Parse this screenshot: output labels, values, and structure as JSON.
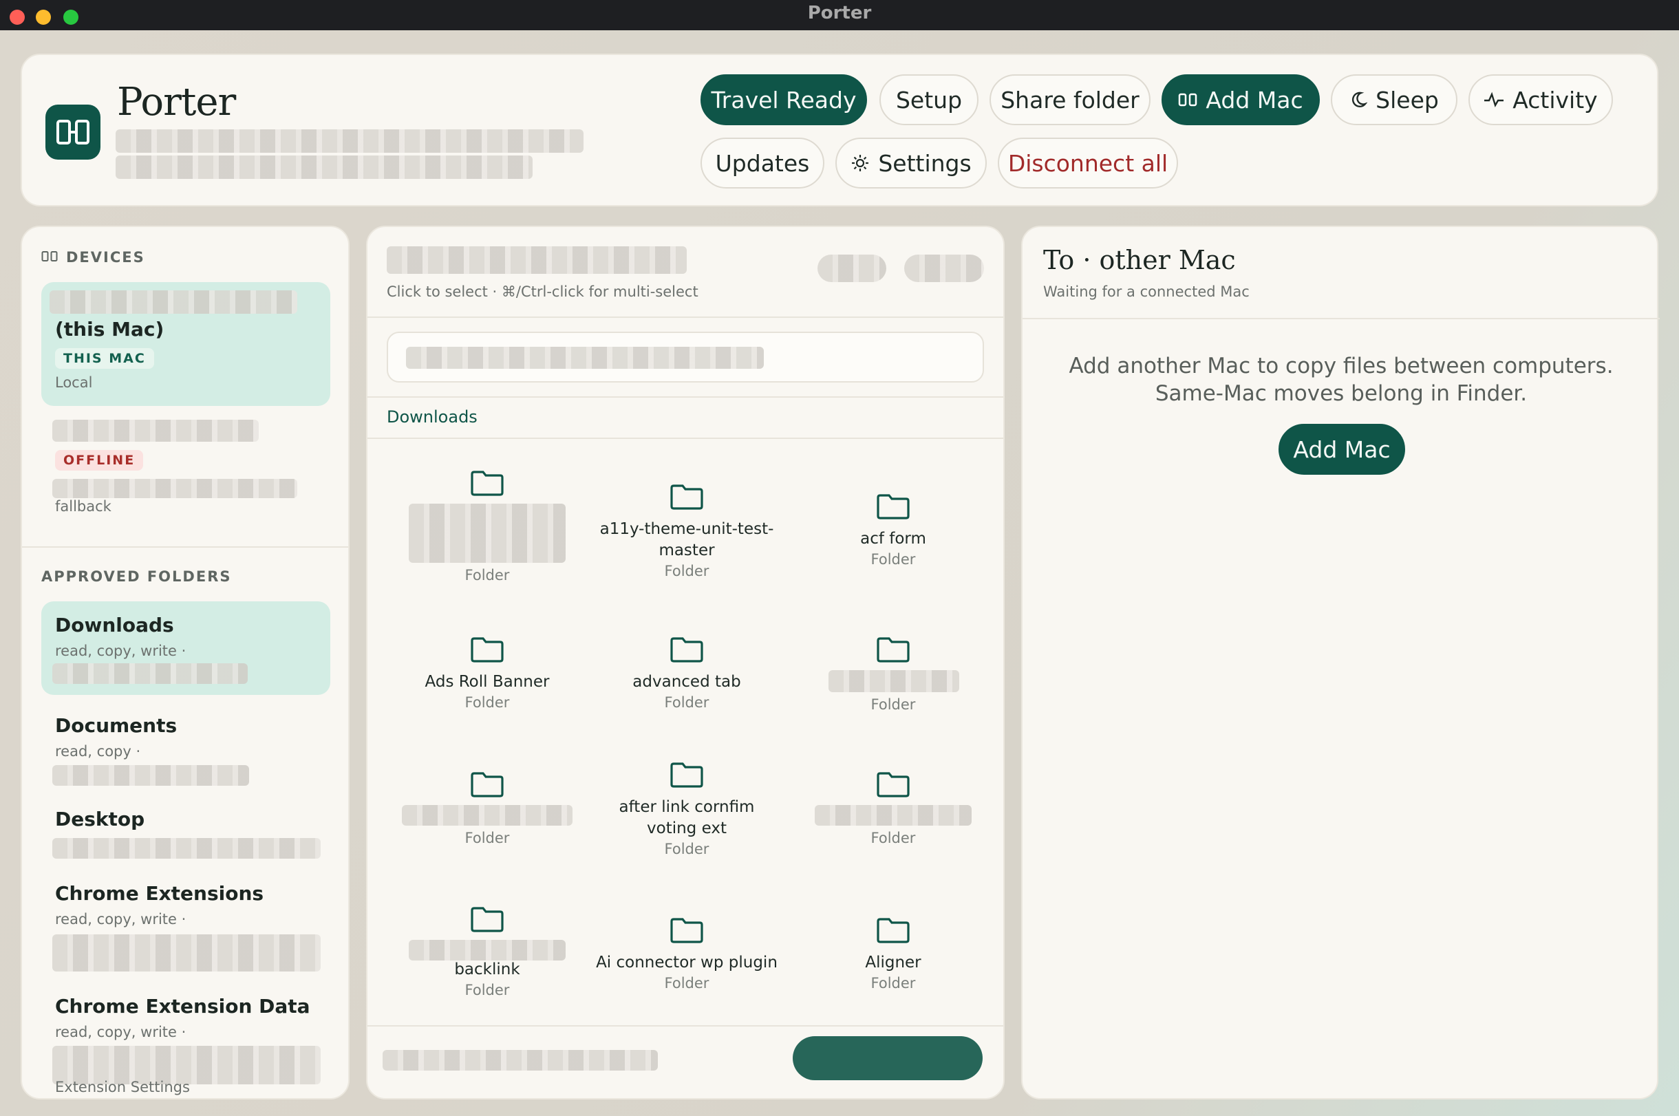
{
  "window": {
    "title": "Porter"
  },
  "header": {
    "app_name": "Porter",
    "buttons": {
      "travel_ready": "Travel Ready",
      "setup": "Setup",
      "share_folder": "Share folder",
      "add_mac": "Add Mac",
      "sleep": "Sleep",
      "activity": "Activity",
      "updates": "Updates",
      "settings": "Settings",
      "disconnect_all": "Disconnect all"
    }
  },
  "sidebar": {
    "devices_label": "DEVICES",
    "this_device": {
      "name": "(this Mac)",
      "tag": "THIS MAC",
      "status": "Local"
    },
    "other_device": {
      "tag": "OFFLINE",
      "status": "fallback"
    },
    "folders_label": "APPROVED FOLDERS",
    "folders": [
      {
        "name": "Downloads",
        "perms": "read, copy, write ·"
      },
      {
        "name": "Documents",
        "perms": "read, copy ·"
      },
      {
        "name": "Desktop",
        "perms": ""
      },
      {
        "name": "Chrome Extensions",
        "perms": "read, copy, write ·"
      },
      {
        "name": "Chrome Extension Data",
        "perms": "read, copy, write ·",
        "extra": "Extension Settings"
      }
    ]
  },
  "browser": {
    "hint": "Click to select · ⌘/Ctrl-click for multi-select",
    "breadcrumb": "Downloads",
    "items": [
      {
        "name": "",
        "kind": "Folder"
      },
      {
        "name": "a11y-theme-unit-test-master",
        "kind": "Folder"
      },
      {
        "name": "acf form",
        "kind": "Folder"
      },
      {
        "name": "Ads Roll Banner",
        "kind": "Folder"
      },
      {
        "name": "advanced tab",
        "kind": "Folder"
      },
      {
        "name": "",
        "kind": "Folder"
      },
      {
        "name": "",
        "kind": "Folder"
      },
      {
        "name": "after link cornfim voting ext",
        "kind": "Folder"
      },
      {
        "name": "",
        "kind": "Folder"
      },
      {
        "name": "backlink",
        "kind": "Folder"
      },
      {
        "name": "Ai connector wp plugin",
        "kind": "Folder"
      },
      {
        "name": "Aligner",
        "kind": "Folder"
      }
    ]
  },
  "destination": {
    "title": "To · other Mac",
    "subtitle": "Waiting for a connected Mac",
    "message_line1": "Add another Mac to copy files between computers.",
    "message_line2": "Same-Mac moves belong in Finder.",
    "add_mac": "Add Mac"
  },
  "colors": {
    "accent": "#0f5548",
    "selected": "#d3ede4",
    "danger": "#a12a2a"
  }
}
